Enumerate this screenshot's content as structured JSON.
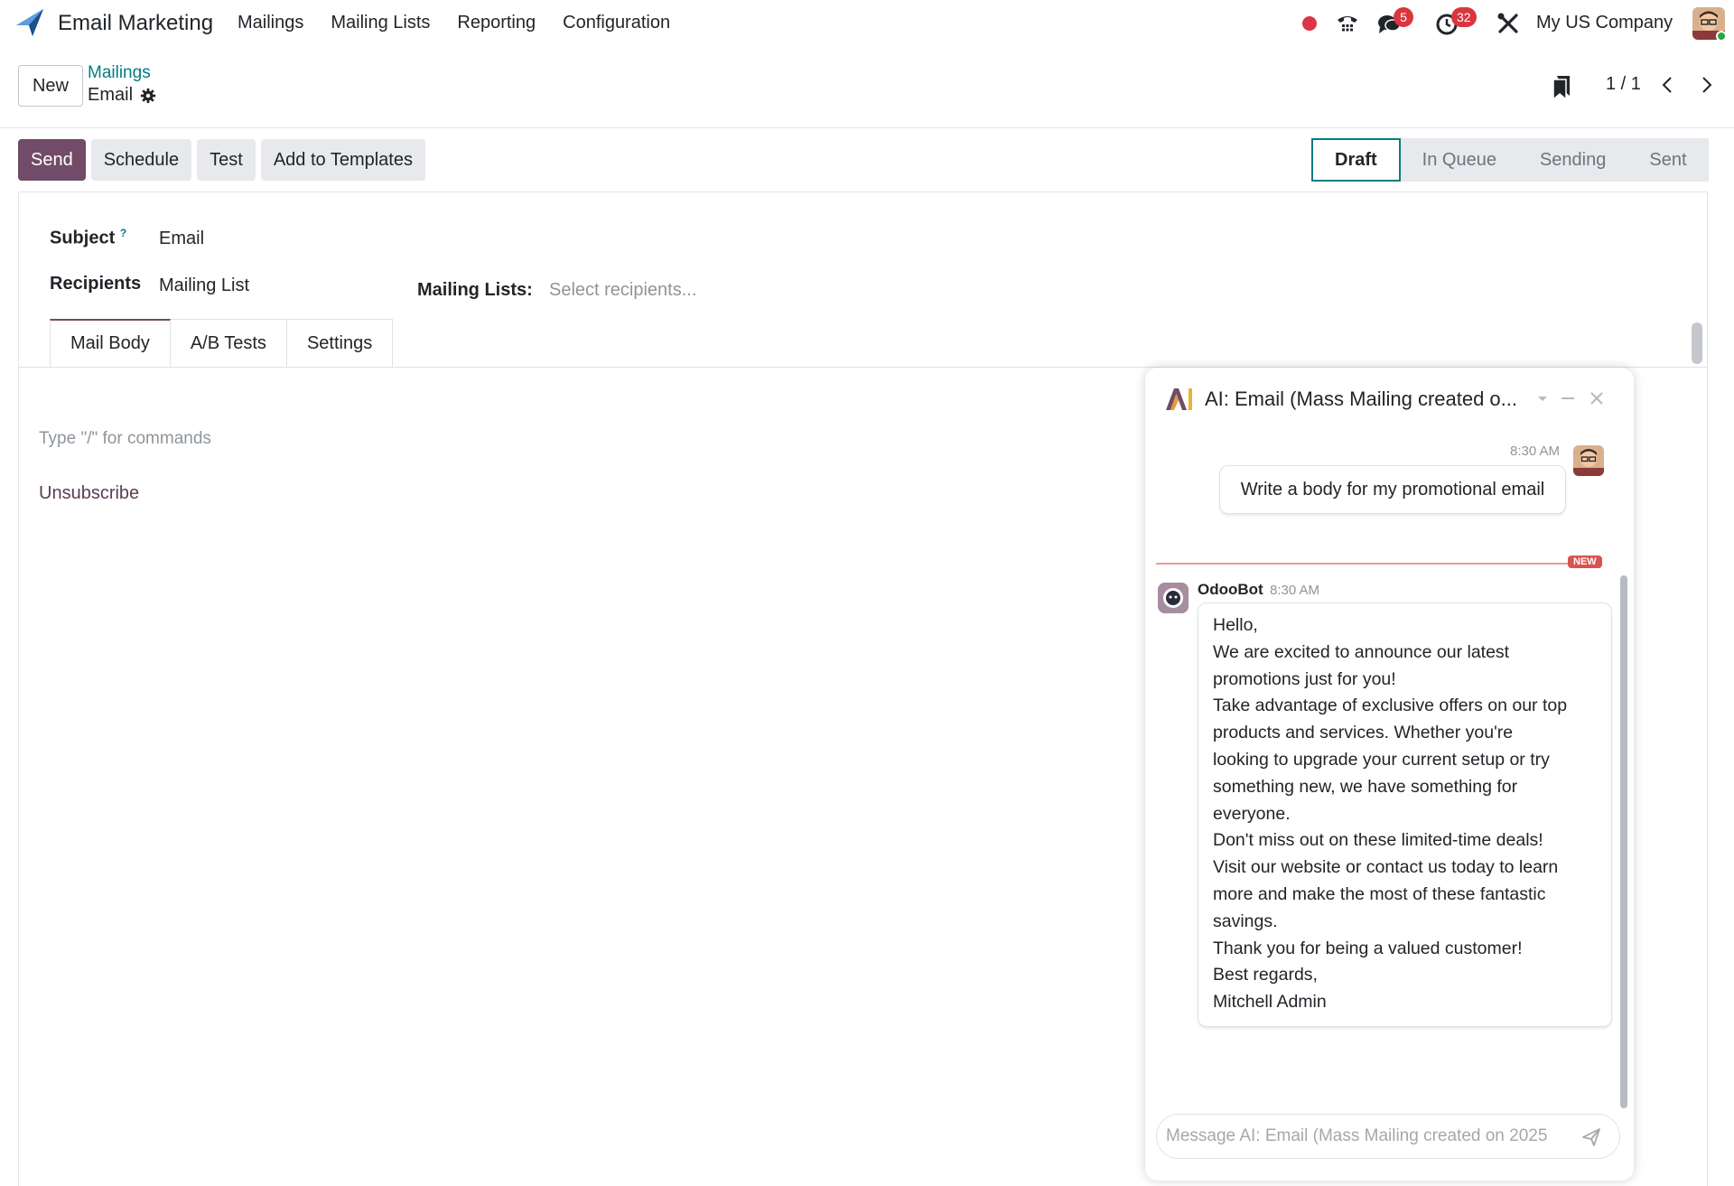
{
  "navbar": {
    "app_name": "Email Marketing",
    "menu": [
      "Mailings",
      "Mailing Lists",
      "Reporting",
      "Configuration"
    ],
    "chat_badge": "5",
    "activity_badge": "32",
    "company": "My US Company",
    "accent_color": "#714b67"
  },
  "control_panel": {
    "new_label": "New",
    "breadcrumb_parent": "Mailings",
    "breadcrumb_current": "Email",
    "pager": "1 / 1"
  },
  "actions": {
    "send": "Send",
    "schedule": "Schedule",
    "test": "Test",
    "add_to_templates": "Add to Templates"
  },
  "statusbar": {
    "stages": [
      "Draft",
      "In Queue",
      "Sending",
      "Sent"
    ],
    "active": "Draft"
  },
  "form": {
    "subject_label": "Subject",
    "subject_help": "?",
    "subject_value": "Email",
    "recipients_label": "Recipients",
    "recipients_value": "Mailing List",
    "mailing_lists_label": "Mailing Lists:",
    "mailing_lists_placeholder": "Select recipients...",
    "tabs": [
      "Mail Body",
      "A/B Tests",
      "Settings"
    ],
    "editor_hint": "Type \"/\" for commands",
    "unsubscribe": "Unsubscribe"
  },
  "chat": {
    "title": "AI: Email (Mass Mailing created o...",
    "user_time": "8:30 AM",
    "user_message": "Write a body for my promotional email",
    "new_badge": "NEW",
    "bot_name": "OdooBot",
    "bot_time": "8:30 AM",
    "bot_lines": [
      "Hello,",
      "We are excited to announce our latest",
      "promotions just for you!",
      "Take advantage of exclusive offers on our top",
      "products and services. Whether you're",
      "looking to upgrade your current setup or try",
      "something new, we have something for",
      "everyone.",
      "Don't miss out on these limited-time deals!",
      "Visit our website or contact us today to learn",
      "more and make the most of these fantastic",
      "savings.",
      "Thank you for being a valued customer!",
      "Best regards,",
      "Mitchell Admin"
    ],
    "input_placeholder": "Message AI: Email (Mass Mailing created on 2025"
  }
}
